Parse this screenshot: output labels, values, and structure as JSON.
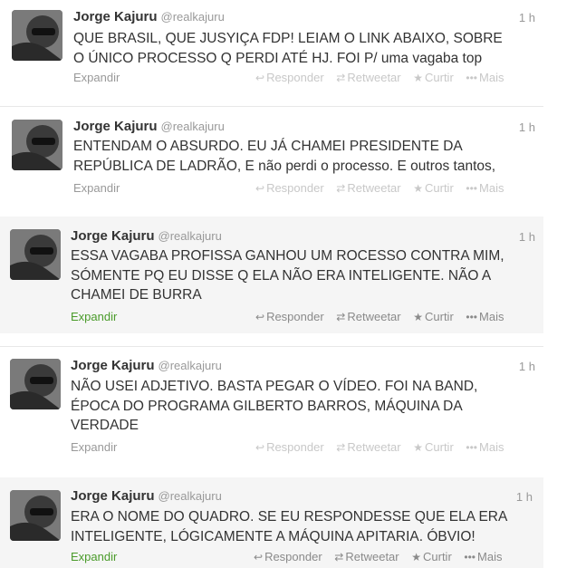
{
  "tweets": [
    {
      "name": "Jorge Kajuru",
      "handle": "@realkajuru",
      "time": "1 h",
      "lines": [
        "QUE BRASIL, QUE JUSYIÇA FDP! LEIAM O LINK ABAIXO, SOBRE",
        "O ÚNICO PROCESSO Q PERDI ATÉ HJ. FOI P/ uma vagaba top"
      ],
      "expand": "Expandir",
      "actions": {
        "reply": "Responder",
        "retweet": "Retweetar",
        "favorite": "Curtir",
        "more": "Mais"
      }
    },
    {
      "name": "Jorge Kajuru",
      "handle": "@realkajuru",
      "time": "1 h",
      "lines": [
        "ENTENDAM O ABSURDO. EU JÁ CHAMEI PRESIDENTE DA",
        "REPÚBLICA DE LADRÃO, E não perdi o processo. E outros tantos,"
      ],
      "expand": "Expandir",
      "actions": {
        "reply": "Responder",
        "retweet": "Retweetar",
        "favorite": "Curtir",
        "more": "Mais"
      }
    },
    {
      "name": "Jorge Kajuru",
      "handle": "@realkajuru",
      "time": "1 h",
      "lines": [
        "ESSA VAGABA PROFISSA GANHOU UM ROCESSO CONTRA MIM,",
        "SÓMENTE PQ EU DISSE Q ELA NÃO ERA INTELIGENTE. NÃO A",
        "CHAMEI DE BURRA"
      ],
      "expand": "Expandir",
      "actions": {
        "reply": "Responder",
        "retweet": "Retweetar",
        "favorite": "Curtir",
        "more": "Mais"
      }
    },
    {
      "name": "Jorge Kajuru",
      "handle": "@realkajuru",
      "time": "1 h",
      "lines": [
        "NÃO USEI ADJETIVO. BASTA PEGAR O VÍDEO. FOI NA BAND,",
        "ÉPOCA DO PROGRAMA GILBERTO BARROS, MÁQUINA DA",
        "VERDADE"
      ],
      "expand": "Expandir",
      "actions": {
        "reply": "Responder",
        "retweet": "Retweetar",
        "favorite": "Curtir",
        "more": "Mais"
      }
    },
    {
      "name": "Jorge Kajuru",
      "handle": "@realkajuru",
      "time": "1 h",
      "lines": [
        "ERA O NOME DO QUADRO. SE EU RESPONDESSE QUE ELA ERA",
        "INTELIGENTE, LÓGICAMENTE A MÁQUINA APITARIA. ÓBVIO!"
      ],
      "expand": "Expandir",
      "actions": {
        "reply": "Responder",
        "retweet": "Retweetar",
        "favorite": "Curtir",
        "more": "Mais"
      }
    }
  ]
}
